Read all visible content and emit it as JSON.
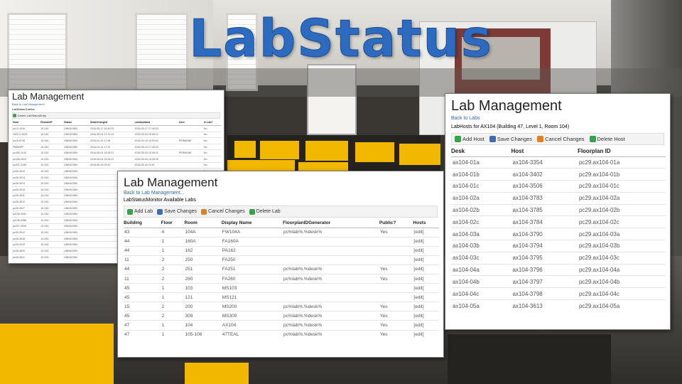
{
  "title": "LabStatus",
  "accent_color": "#2d6bc0",
  "panel_left": {
    "title": "Lab Management",
    "back_link": "Back to Lab Management",
    "heading": "LabStatus Entries",
    "toolbar": {
      "delete_label": "Delete LabStatusEntry"
    },
    "columns": [
      "Host",
      "RemoteIP",
      "Status",
      "StateChanged",
      "LastUpdated",
      "User",
      "In Lab?"
    ],
    "rows": [
      [
        "pc10-1016",
        "10.243.",
        "UNKNOWN",
        "2016-05-17 14:40:33",
        "2016-05-17 17:49:03",
        "",
        "No"
      ],
      [
        "1620.2-1025",
        "10.243.",
        "UNKNOWN",
        "2016-05-04 17:31:23",
        "2016-05-04 15:26:21",
        "",
        "No"
      ],
      [
        "pc16-6745",
        "10.243.",
        "UNKNOWN",
        "2016-04-15 17:48",
        "2016-04-15 18:03:42",
        "PERMANE",
        "No"
      ],
      [
        "PMMAPP",
        "10.243.",
        "UNKNOWN",
        "2016-04-14 17:31",
        "2016-05-19 17:49:03",
        "",
        "No"
      ],
      [
        "pc435-1105",
        "10.243.",
        "UNKNOWN",
        "2016-05-04 15:26:21",
        "2016-05-04 15:26:21",
        "PERMANE",
        "No"
      ],
      [
        "pc436-0022",
        "10.243.",
        "UNKNOWN",
        "2016-05-04 15:26:21",
        "2016-05-04 15:26:33",
        "",
        "No"
      ],
      [
        "pc201-3106",
        "10.243.",
        "UNKNOWN",
        "2016-06-24 09:10",
        "2016-06-24 10:01",
        "",
        "No"
      ],
      [
        "pc28-2615",
        "10.243.",
        "UNKNOWN",
        "",
        "",
        "",
        "No"
      ],
      [
        "pc28-2613",
        "10.243.",
        "UNKNOWN",
        "",
        "",
        "",
        "No"
      ],
      [
        "pc28-2614",
        "10.243.",
        "UNKNOWN",
        "",
        "",
        "",
        "No"
      ],
      [
        "pc28-2616",
        "10.243.",
        "UNKNOWN",
        "",
        "",
        "",
        "No"
      ],
      [
        "pc28-2611",
        "10.243.",
        "UNKNOWN",
        "",
        "",
        "",
        "No"
      ],
      [
        "pc28-2612",
        "10.243.",
        "UNKNOWN",
        "",
        "",
        "",
        "No"
      ],
      [
        "pc28-2617",
        "10.243.",
        "UNKNOWN",
        "",
        "",
        "",
        "No"
      ],
      [
        "pc136-0281",
        "10.243.",
        "UNKNOWN",
        "",
        "",
        "",
        "No"
      ],
      [
        "pc136-0288",
        "10.243.",
        "UNKNOWN",
        "",
        "",
        "",
        "No"
      ],
      [
        "pc207-0006",
        "10.243.",
        "UNKNOWN",
        "",
        "",
        "",
        "No"
      ],
      [
        "pc28-2612",
        "10.243.",
        "UNKNOWN",
        "",
        "",
        "",
        "No"
      ],
      [
        "pc28-2618",
        "10.243.",
        "UNKNOWN",
        "",
        "",
        "",
        "No"
      ],
      [
        "pc28-2619",
        "10.243.",
        "UNKNOWN",
        "",
        "",
        "",
        "No"
      ],
      [
        "pc28-2620",
        "10.243.",
        "UNKNOWN",
        "",
        "",
        "",
        "No"
      ],
      [
        "pc28-2621",
        "10.243.",
        "UNKNOWN",
        "",
        "",
        "",
        "No"
      ]
    ]
  },
  "panel_middle": {
    "title": "Lab Management",
    "back_link": "Back to Lab Management...",
    "heading": "LabStatusMonitor Available Labs",
    "toolbar": {
      "add_label": "Add Lab",
      "save_label": "Save Changes",
      "cancel_label": "Cancel Changes",
      "delete_label": "Delete Lab"
    },
    "columns": [
      "Building",
      "Floor",
      "Room",
      "Display Name",
      "FloorplanIDGenerator",
      "Public?",
      "Hosts"
    ],
    "rows": [
      [
        "43",
        "4",
        "104A",
        "FW104A",
        "pc%lab%.%desk%",
        "Yes",
        "[edit]"
      ],
      [
        "44",
        "1",
        "160A",
        "FA160A",
        "",
        "",
        "[edit]"
      ],
      [
        "44",
        "1",
        "162",
        "PA162",
        "",
        "",
        "[edit]"
      ],
      [
        "11",
        "2",
        "250",
        "FA250",
        "",
        "",
        "[edit]"
      ],
      [
        "44",
        "2",
        "251",
        "FA251",
        "pc%lab%.%desk%",
        "Yes",
        "[edit]"
      ],
      [
        "11",
        "2",
        "260",
        "FA260",
        "pc%lab%.%desk%",
        "Yes",
        "[edit]"
      ],
      [
        "45",
        "1",
        "103",
        "MS103",
        "",
        "",
        "[edit]"
      ],
      [
        "45",
        "1",
        "121",
        "MS121",
        "",
        "",
        "[edit]"
      ],
      [
        "15",
        "2",
        "200",
        "MS200",
        "pc%lab%.%desk%",
        "Yes",
        "[edit]"
      ],
      [
        "45",
        "2",
        "309",
        "MS309",
        "pc%lab%.%desk%",
        "Yes",
        "[edit]"
      ],
      [
        "47",
        "1",
        "104",
        "AX104",
        "pc%lab%.%desk%",
        "Yes",
        "[edit]"
      ],
      [
        "47",
        "1",
        "105-106",
        "47TEAL",
        "pc%lab%.%desk%",
        "Yes",
        "[edit]"
      ]
    ]
  },
  "panel_right": {
    "title": "Lab Management",
    "back_link": "Back to Labs",
    "heading": "LabHosts for AX104 (Building 47, Level 1, Room 104)",
    "toolbar": {
      "add_label": "Add Host",
      "save_label": "Save Changes",
      "cancel_label": "Cancel Changes",
      "delete_label": "Delete Host"
    },
    "columns": [
      "Desk",
      "Host",
      "Floorplan ID"
    ],
    "rows": [
      [
        "ax104-01a",
        "ax104-3354",
        "pc29.ax104-01a"
      ],
      [
        "ax104-01b",
        "ax104-3402",
        "pc29.ax104-01b"
      ],
      [
        "ax104-01c",
        "ax104-3506",
        "pc29.ax104-01c"
      ],
      [
        "ax104-02a",
        "ax104-3783",
        "pc29.ax104-02a"
      ],
      [
        "ax104-02b",
        "ax104-3785",
        "pc29.ax104-02b"
      ],
      [
        "ax104-02c",
        "ax104-3784",
        "pc29.ax104-02c"
      ],
      [
        "ax104-03a",
        "ax104-3790",
        "pc29.ax104-03a"
      ],
      [
        "ax104-03b",
        "ax104-3794",
        "pc29.ax104-03b"
      ],
      [
        "ax104-03c",
        "ax104-3795",
        "pc29.ax104-03c"
      ],
      [
        "ax104-04a",
        "ax104-3796",
        "pc29.ax104-04a"
      ],
      [
        "ax104-04b",
        "ax104-3797",
        "pc29.ax104-04b"
      ],
      [
        "ax104-04c",
        "ax104-3798",
        "pc29.ax104-04c"
      ],
      [
        "ax104-05a",
        "ax104-3613",
        "pc29.ax104-05a"
      ]
    ]
  }
}
